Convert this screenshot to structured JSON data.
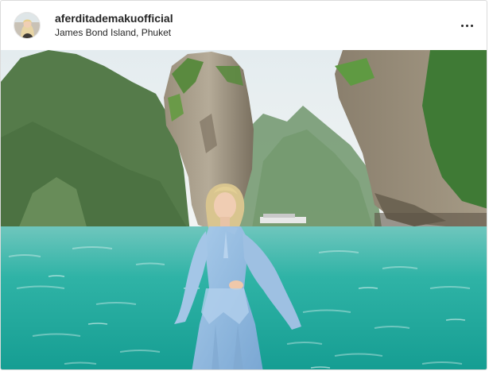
{
  "post": {
    "username": "aferditademakuofficial",
    "location": "James Bond Island, Phuket"
  },
  "icons": {
    "avatar": "profile-photo",
    "more": "more-options-icon"
  },
  "colors": {
    "water": "#3fb8ad",
    "sky": "#e9eef0",
    "dress": "#8db6de",
    "rock": "#8d8578",
    "foliage": "#4e7d3d"
  }
}
